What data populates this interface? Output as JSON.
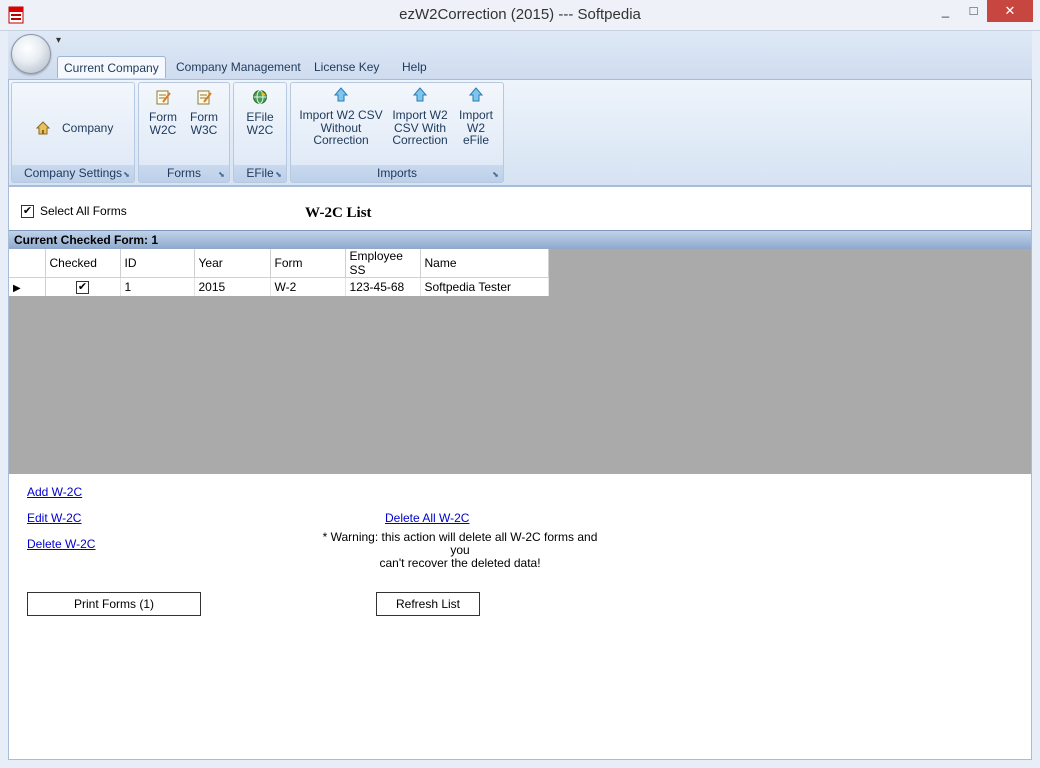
{
  "window": {
    "title": "ezW2Correction (2015) --- Softpedia",
    "minimize": "_",
    "maximize": "□",
    "close": "✕"
  },
  "qat": {
    "dropdown": "▾"
  },
  "ribbon": {
    "tabs": [
      "Current Company",
      "Company Management",
      "License Key",
      "Help"
    ],
    "groups": {
      "company_settings": {
        "label": "Company Settings",
        "buttons": {
          "company": "Company"
        }
      },
      "forms": {
        "label": "Forms",
        "buttons": {
          "form_w2c_1": "Form",
          "form_w2c_2": "W2C",
          "form_w3c_1": "Form",
          "form_w3c_2": "W3C"
        }
      },
      "efile": {
        "label": "EFile",
        "buttons": {
          "efile_1": "EFile",
          "efile_2": "W2C"
        }
      },
      "imports": {
        "label": "Imports",
        "buttons": {
          "csv_without_1": "Import W2 CSV",
          "csv_without_2": "Without",
          "csv_without_3": "Correction",
          "csv_with_1": "Import W2",
          "csv_with_2": "CSV With",
          "csv_with_3": "Correction",
          "efile_1": "Import",
          "efile_2": "W2",
          "efile_3": "eFile"
        }
      }
    }
  },
  "content": {
    "select_all_label": "Select All Forms",
    "select_all_checked": true,
    "list_title": "W-2C List",
    "current_checked_label": "Current Checked Form: 1",
    "columns": [
      "Checked",
      "ID",
      "Year",
      "Form",
      "Employee SS",
      "Name"
    ],
    "rows": [
      {
        "checked": "✔",
        "id": "1",
        "year": "2015",
        "form": "W-2",
        "ssn": "123-45-68",
        "name": "Softpedia Tester"
      }
    ],
    "links": {
      "add": "Add W-2C",
      "edit": "Edit W-2C",
      "delete": "Delete W-2C",
      "delete_all": "Delete All W-2C"
    },
    "warning_line1": "* Warning: this action will delete all W-2C forms and you",
    "warning_line2": "can't recover the deleted data!",
    "print_button": "Print Forms (1)",
    "refresh_button": "Refresh List"
  }
}
